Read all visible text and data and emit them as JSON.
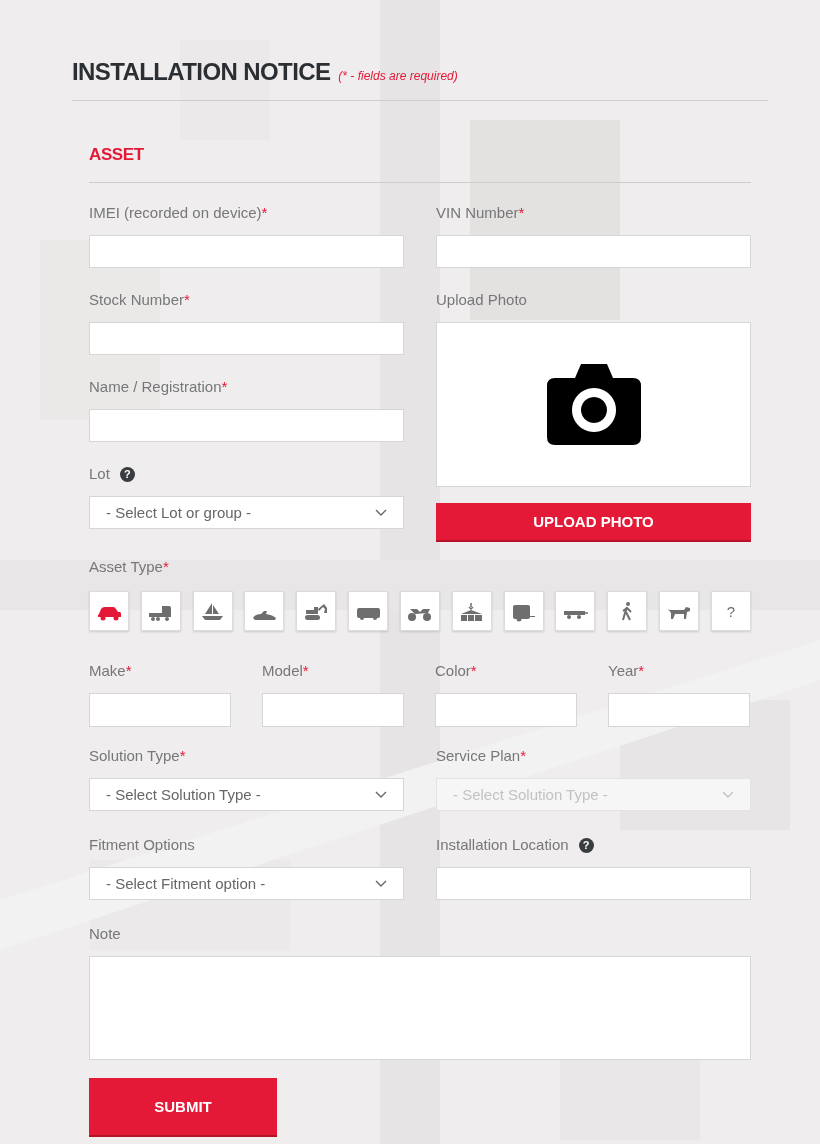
{
  "header": {
    "title": "INSTALLATION NOTICE",
    "note": "(* - fields are required)"
  },
  "section": {
    "title": "ASSET"
  },
  "left_column": [
    {
      "kind": "text",
      "label": "IMEI (recorded on device)",
      "mark": "*"
    },
    {
      "kind": "text",
      "label": "Stock Number",
      "mark": "*"
    },
    {
      "kind": "text",
      "label": "Name / Registration",
      "mark": "*"
    },
    {
      "kind": "select",
      "label": "Lot",
      "help": "?",
      "value": "- Select Lot or group -",
      "disabled": false
    }
  ],
  "right_column": [
    {
      "kind": "text",
      "label": "VIN Number",
      "mark": "*"
    },
    {
      "label": "Upload Photo",
      "button": "UPLOAD PHOTO"
    }
  ],
  "asset_type": {
    "label": "Asset Type",
    "mark": "*",
    "types": [
      {
        "kind": "car",
        "selected": true
      },
      {
        "kind": "truck",
        "selected": false
      },
      {
        "kind": "sailboat",
        "selected": false
      },
      {
        "kind": "jetski",
        "selected": false
      },
      {
        "kind": "excavator",
        "selected": false
      },
      {
        "kind": "bus",
        "selected": false
      },
      {
        "kind": "quad",
        "selected": false
      },
      {
        "kind": "cargo",
        "selected": false
      },
      {
        "kind": "trailer",
        "selected": false
      },
      {
        "kind": "flatbed",
        "selected": false
      },
      {
        "kind": "walker",
        "selected": false
      },
      {
        "kind": "dog",
        "selected": false
      },
      {
        "kind": "other",
        "label": "?",
        "selected": false
      }
    ]
  },
  "details_row": [
    {
      "kind": "text",
      "label": "Make",
      "mark": "*"
    },
    {
      "kind": "text",
      "label": "Model",
      "mark": "*"
    },
    {
      "kind": "text",
      "label": "Color",
      "mark": "*"
    },
    {
      "kind": "text",
      "label": "Year",
      "mark": "*"
    }
  ],
  "pair_rows": [
    [
      {
        "kind": "select",
        "label": "Solution Type",
        "mark": "*",
        "value": "- Select Solution Type -",
        "disabled": false
      },
      {
        "kind": "select",
        "label": "Service Plan",
        "mark": "*",
        "value": "- Select Solution Type -",
        "disabled": true
      }
    ],
    [
      {
        "kind": "select",
        "label": "Fitment Options",
        "value": "- Select Fitment option -",
        "disabled": false
      },
      {
        "kind": "text",
        "label": "Installation Location",
        "help": "?"
      }
    ]
  ],
  "note": {
    "label": "Note"
  },
  "submit": {
    "label": "SUBMIT"
  }
}
